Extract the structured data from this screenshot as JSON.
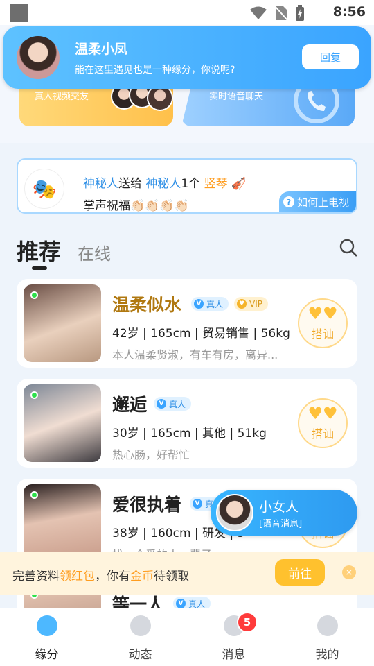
{
  "status_bar": {
    "time": "8:56"
  },
  "feature_cards": {
    "video_label": "真人视频交友",
    "voice_label": "实时语音聊天"
  },
  "notification": {
    "name": "温柔小凤",
    "message": "能在这里遇见也是一种缘分，你说呢?",
    "reply_label": "回复"
  },
  "gift_broadcast": {
    "sender": "神秘人",
    "verb": "送给",
    "receiver": "神秘人",
    "count": "1个",
    "gift": "竖琴",
    "blessing": "掌声祝福👏🏻👏🏻👏🏻👏🏻",
    "how_label": "如何上电视",
    "help_icon": "?"
  },
  "tabs": {
    "recommend": "推荐",
    "online": "在线"
  },
  "users": [
    {
      "name": "温柔似水",
      "real_badge": "真人",
      "vip_badge": "VIP",
      "stats": "42岁 | 165cm | 贸易销售 | 56kg",
      "bio": "本人温柔贤淑，有车有房，离异...",
      "chat_label": "搭讪"
    },
    {
      "name": "邂逅",
      "real_badge": "真人",
      "stats": "30岁 | 165cm | 其他 | 51kg",
      "bio": "热心肠，好帮忙",
      "chat_label": "搭讪"
    },
    {
      "name": "爱很执着",
      "real_badge": "真人",
      "stats": "38岁 | 160cm | 研发 | 5",
      "bio": "找一个爱的人一辈子",
      "chat_label": "搭讪"
    },
    {
      "name": "等一人",
      "real_badge": "真人"
    }
  ],
  "voice_popup": {
    "name": "小女人",
    "tag": "[语音消息]"
  },
  "promo": {
    "text_a": "完善资料",
    "text_b": "领红包",
    "text_c": "，你有",
    "text_d": "金币",
    "text_e": "待领取",
    "button": "前往",
    "close": "×"
  },
  "tabbar": {
    "items": [
      "缘分",
      "动态",
      "消息",
      "我的"
    ],
    "message_badge": "5"
  },
  "colors": {
    "accent": "#3aa4ff",
    "gold": "#ffc12e",
    "online": "#2ee14b"
  }
}
